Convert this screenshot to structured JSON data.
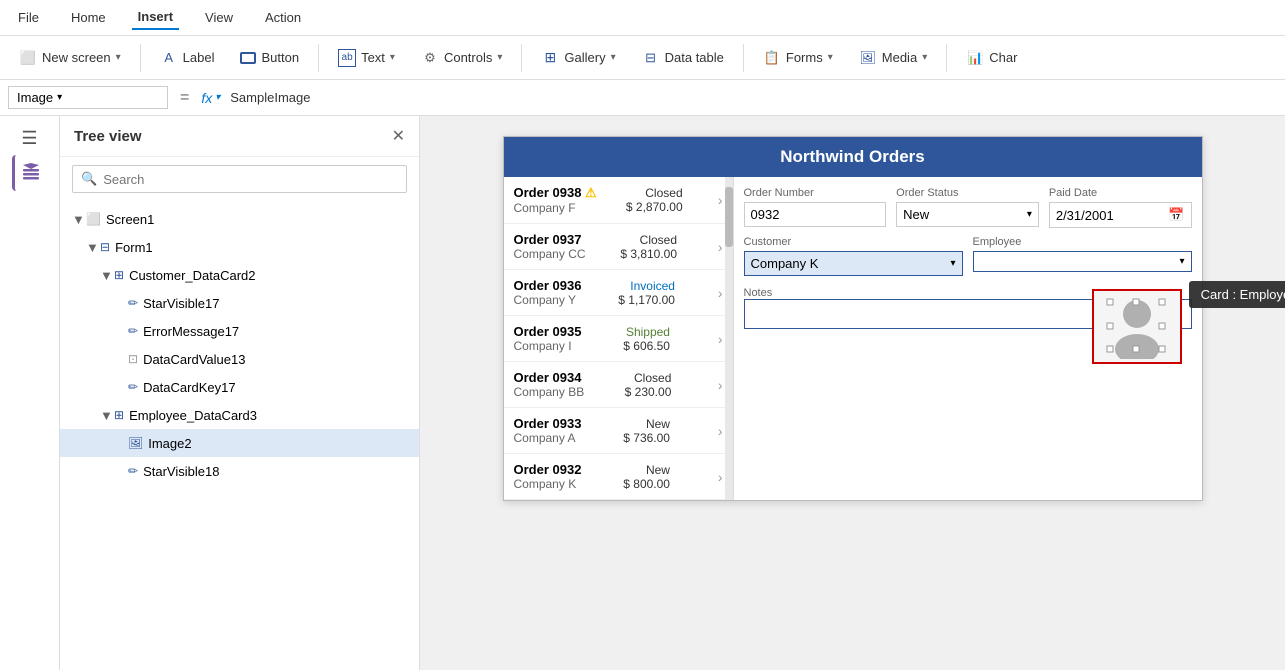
{
  "menu": {
    "items": [
      "File",
      "Home",
      "Insert",
      "View",
      "Action"
    ],
    "active": "Insert"
  },
  "toolbar": {
    "new_screen": "New screen",
    "label": "Label",
    "button": "Button",
    "text": "Text",
    "controls": "Controls",
    "gallery": "Gallery",
    "data_table": "Data table",
    "forms": "Forms",
    "media": "Media",
    "chart": "Char"
  },
  "formula_bar": {
    "selector_value": "Image",
    "eq": "=",
    "fx_label": "fx",
    "formula_value": "SampleImage"
  },
  "tree": {
    "title": "Tree view",
    "search_placeholder": "Search",
    "items": [
      {
        "label": "Screen1",
        "level": 0,
        "type": "screen",
        "expandable": true,
        "expanded": true
      },
      {
        "label": "Form1",
        "level": 1,
        "type": "form",
        "expandable": true,
        "expanded": true
      },
      {
        "label": "Customer_DataCard2",
        "level": 2,
        "type": "datacard",
        "expandable": true,
        "expanded": true
      },
      {
        "label": "StarVisible17",
        "level": 3,
        "type": "star"
      },
      {
        "label": "ErrorMessage17",
        "level": 3,
        "type": "star"
      },
      {
        "label": "DataCardValue13",
        "level": 3,
        "type": "input"
      },
      {
        "label": "DataCardKey17",
        "level": 3,
        "type": "star"
      },
      {
        "label": "Employee_DataCard3",
        "level": 2,
        "type": "datacard",
        "expandable": true,
        "expanded": true
      },
      {
        "label": "Image2",
        "level": 3,
        "type": "image",
        "selected": true
      },
      {
        "label": "StarVisible18",
        "level": 3,
        "type": "star"
      }
    ]
  },
  "app": {
    "title": "Northwind Orders",
    "orders": [
      {
        "id": "Order 0938",
        "company": "Company F",
        "status": "Closed",
        "amount": "$ 2,870.00",
        "status_type": "closed",
        "warning": true
      },
      {
        "id": "Order 0937",
        "company": "Company CC",
        "status": "Closed",
        "amount": "$ 3,810.00",
        "status_type": "closed"
      },
      {
        "id": "Order 0936",
        "company": "Company Y",
        "status": "Invoiced",
        "amount": "$ 1,170.00",
        "status_type": "invoiced"
      },
      {
        "id": "Order 0935",
        "company": "Company I",
        "status": "Shipped",
        "amount": "$ 606.50",
        "status_type": "shipped"
      },
      {
        "id": "Order 0934",
        "company": "Company BB",
        "status": "Closed",
        "amount": "$ 230.00",
        "status_type": "closed"
      },
      {
        "id": "Order 0933",
        "company": "Company A",
        "status": "New",
        "amount": "$ 736.00",
        "status_type": "new"
      },
      {
        "id": "Order 0932",
        "company": "Company K",
        "status": "New",
        "amount": "$ 800.00",
        "status_type": "new"
      }
    ],
    "detail": {
      "order_number_label": "Order Number",
      "order_number_value": "0932",
      "order_status_label": "Order Status",
      "order_status_value": "New",
      "paid_date_label": "Paid Date",
      "paid_date_value": "2/31/2001",
      "customer_label": "Customer",
      "customer_value": "Company K",
      "employee_label": "Employee",
      "notes_label": "Notes"
    },
    "tooltip": "Card : Employee"
  }
}
